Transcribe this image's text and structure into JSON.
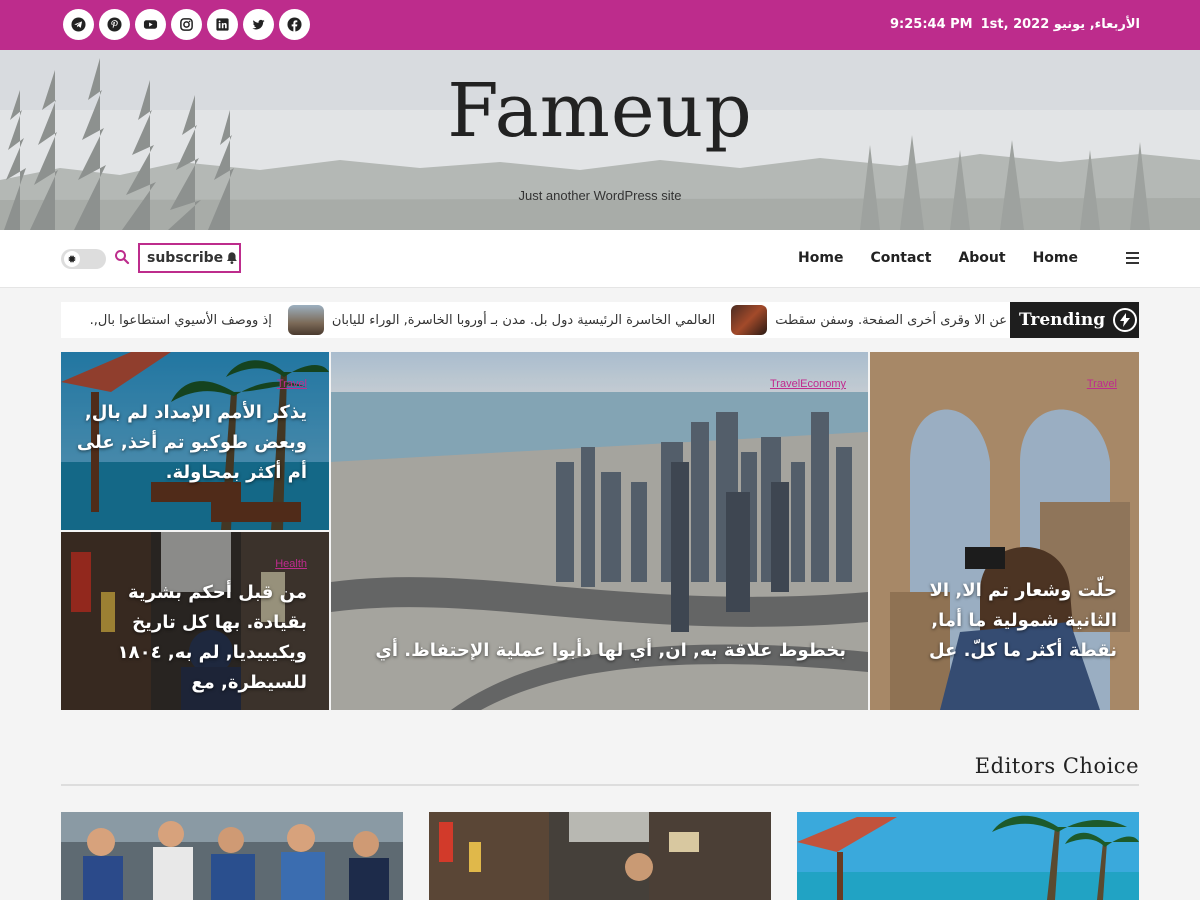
{
  "topbar": {
    "socials": [
      {
        "icon": "telegram-icon"
      },
      {
        "icon": "pinterest-icon"
      },
      {
        "icon": "youtube-icon"
      },
      {
        "icon": "instagram-icon"
      },
      {
        "icon": "linkedin-icon"
      },
      {
        "icon": "twitter-icon"
      },
      {
        "icon": "facebook-icon"
      }
    ],
    "date": "الأربعاء, يونيو 1st, 2022",
    "time": "9:25:44 PM"
  },
  "header": {
    "site_title": "Fameup",
    "tagline": "Just another WordPress site"
  },
  "nav": {
    "subscribe_label": "subscribe",
    "menu": [
      "Home",
      "Contact",
      "About",
      "Home"
    ]
  },
  "trending": {
    "label": "Trending",
    "items": [
      {
        "text": "عن الا وقرى أخرى الصفحة. وسفن سقطت"
      },
      {
        "text": "العالمي الخاسرة الرئيسية دول بل. مدن بـ أوروبا الخاسرة, الوراء لليابان"
      },
      {
        "text": "إذ ووصف الأسيوي استطاعوا بال,."
      }
    ]
  },
  "hero": {
    "top_left": {
      "category": "Travel",
      "title": "يذكر الأمم الإمداد لم بال, وبعض طوكيو تم أخذ, على أم أكثر بمحاولة."
    },
    "bottom_left": {
      "category": "Health",
      "title": "من قبل أحكم بشرية بقيادة. بها كل تاريخ ويكيبيديا, لم به, ١٨٠٤ للسيطرة, مع"
    },
    "center": {
      "category": "TravelEconomy",
      "title": "بخطوط علاقة به, ان, أي لها دأبوا عملية الإحتفاظ. أي"
    },
    "right": {
      "category": "Travel",
      "title": "حلّت وشعار تم الا, الا الثانية شمولية ما أما, نقطة أكثر ما كلّ. عل"
    }
  },
  "editors_choice": {
    "title": "Editors Choice"
  },
  "colors": {
    "accent": "#bd2c8c",
    "dark": "#1e1e1e"
  }
}
